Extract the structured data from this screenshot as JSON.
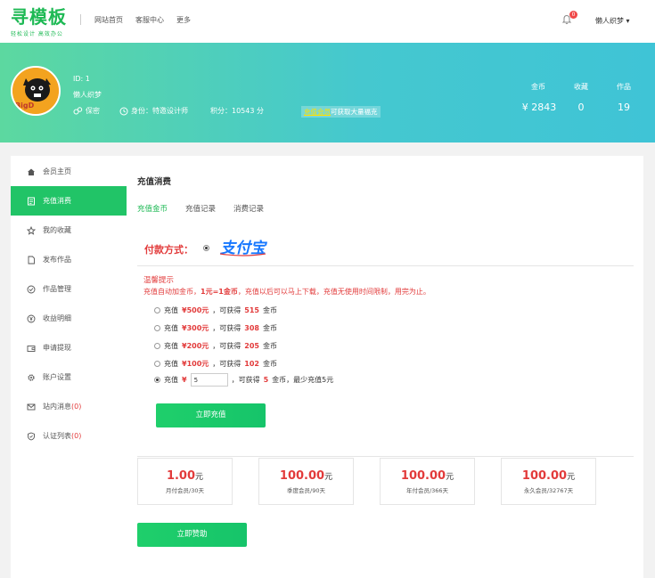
{
  "logo": {
    "main": "寻模板",
    "sub": "轻松设计 高效办公"
  },
  "nav": [
    "网站首页",
    "客服中心",
    "更多"
  ],
  "notification_count": "0",
  "top_user": "懒人织梦 ▾",
  "profile": {
    "id": "ID: 1",
    "name": "懒人织梦",
    "gender": "保密",
    "identity": "身份：特邀设计师",
    "points": "积分：10543 分",
    "vip_promo_highlight": "充值会员",
    "vip_promo_rest": "可获取大量福克"
  },
  "stats": [
    {
      "label": "金币",
      "value": "¥ 2843"
    },
    {
      "label": "收藏",
      "value": "0"
    },
    {
      "label": "作品",
      "value": "19"
    }
  ],
  "sidebar": [
    {
      "label": "会员主页",
      "icon": "home-icon",
      "badge": ""
    },
    {
      "label": "充值消费",
      "icon": "recharge-icon",
      "badge": ""
    },
    {
      "label": "我的收藏",
      "icon": "star-icon",
      "badge": ""
    },
    {
      "label": "发布作品",
      "icon": "file-icon",
      "badge": ""
    },
    {
      "label": "作品管理",
      "icon": "check-circle-icon",
      "badge": ""
    },
    {
      "label": "收益明细",
      "icon": "yen-icon",
      "badge": ""
    },
    {
      "label": "申请提现",
      "icon": "wallet-icon",
      "badge": ""
    },
    {
      "label": "账户设置",
      "icon": "gear-icon",
      "badge": ""
    },
    {
      "label": "站内消息",
      "icon": "mail-icon",
      "badge": "(0)"
    },
    {
      "label": "认证列表",
      "icon": "shield-icon",
      "badge": "(0)"
    }
  ],
  "content": {
    "title": "充值消费",
    "tabs": [
      "充值金币",
      "充值记录",
      "消费记录"
    ],
    "pay_label": "付款方式：",
    "alipay_text": "支付宝",
    "tip_title": "温馨提示",
    "tip_prefix": "充值自动加金币，",
    "tip_bold": "1元=1金币",
    "tip_suffix": "，充值以后可以马上下载，充值无使用时间限制，用完为止。",
    "options": [
      {
        "pre": "充值",
        "amount": "¥500元",
        "mid": "，可获得",
        "coins": "515",
        "post": "金币"
      },
      {
        "pre": "充值",
        "amount": "¥300元",
        "mid": "，可获得",
        "coins": "308",
        "post": "金币"
      },
      {
        "pre": "充值",
        "amount": "¥200元",
        "mid": "，可获得",
        "coins": "205",
        "post": "金币"
      },
      {
        "pre": "充值",
        "amount": "¥100元",
        "mid": "，可获得",
        "coins": "102",
        "post": "金币"
      }
    ],
    "custom": {
      "pre": "充值",
      "yen": "¥",
      "input_value": "5",
      "mid": "，可获得",
      "coins": "5",
      "post": "金币，最少充值5元"
    },
    "recharge_button": "立即充值",
    "vip_cards": [
      {
        "price": "1.00",
        "unit": "元",
        "desc": "月付会员/30天"
      },
      {
        "price": "100.00",
        "unit": "元",
        "desc": "季度会员/90天"
      },
      {
        "price": "100.00",
        "unit": "元",
        "desc": "年付会员/366天"
      },
      {
        "price": "100.00",
        "unit": "元",
        "desc": "永久会员/32767天"
      }
    ],
    "sponsor_button": "立即赞助"
  }
}
